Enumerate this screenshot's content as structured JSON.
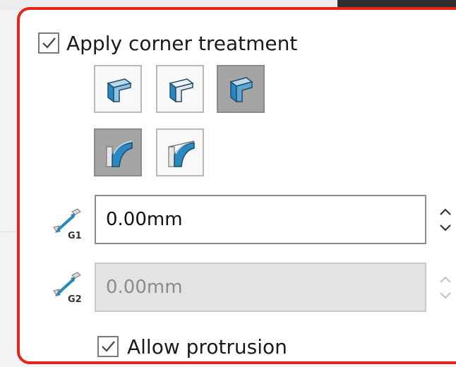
{
  "corner_treatment": {
    "checkbox_label": "Apply corner treatment",
    "checked": true,
    "corner_buttons": [
      {
        "icon": "corner-overlap-icon",
        "selected": false
      },
      {
        "icon": "corner-underlap-icon",
        "selected": false
      },
      {
        "icon": "corner-butt-icon",
        "selected": true
      }
    ],
    "edge_buttons": [
      {
        "icon": "trim-corner-icon",
        "selected": true
      },
      {
        "icon": "extend-corner-icon",
        "selected": false
      }
    ]
  },
  "gap1": {
    "icon": "gap-distance-g1-icon",
    "icon_text": "G1",
    "value": "0.00mm",
    "enabled": true
  },
  "gap2": {
    "icon": "gap-distance-g2-icon",
    "icon_text": "G2",
    "value": "0.00mm",
    "enabled": false
  },
  "allow_protrusion": {
    "label": "Allow protrusion",
    "checked": true
  },
  "colors": {
    "highlight_border": "#e1261c",
    "selected_button": "#a4a4a4",
    "icon_blue": "#2a87bf"
  }
}
